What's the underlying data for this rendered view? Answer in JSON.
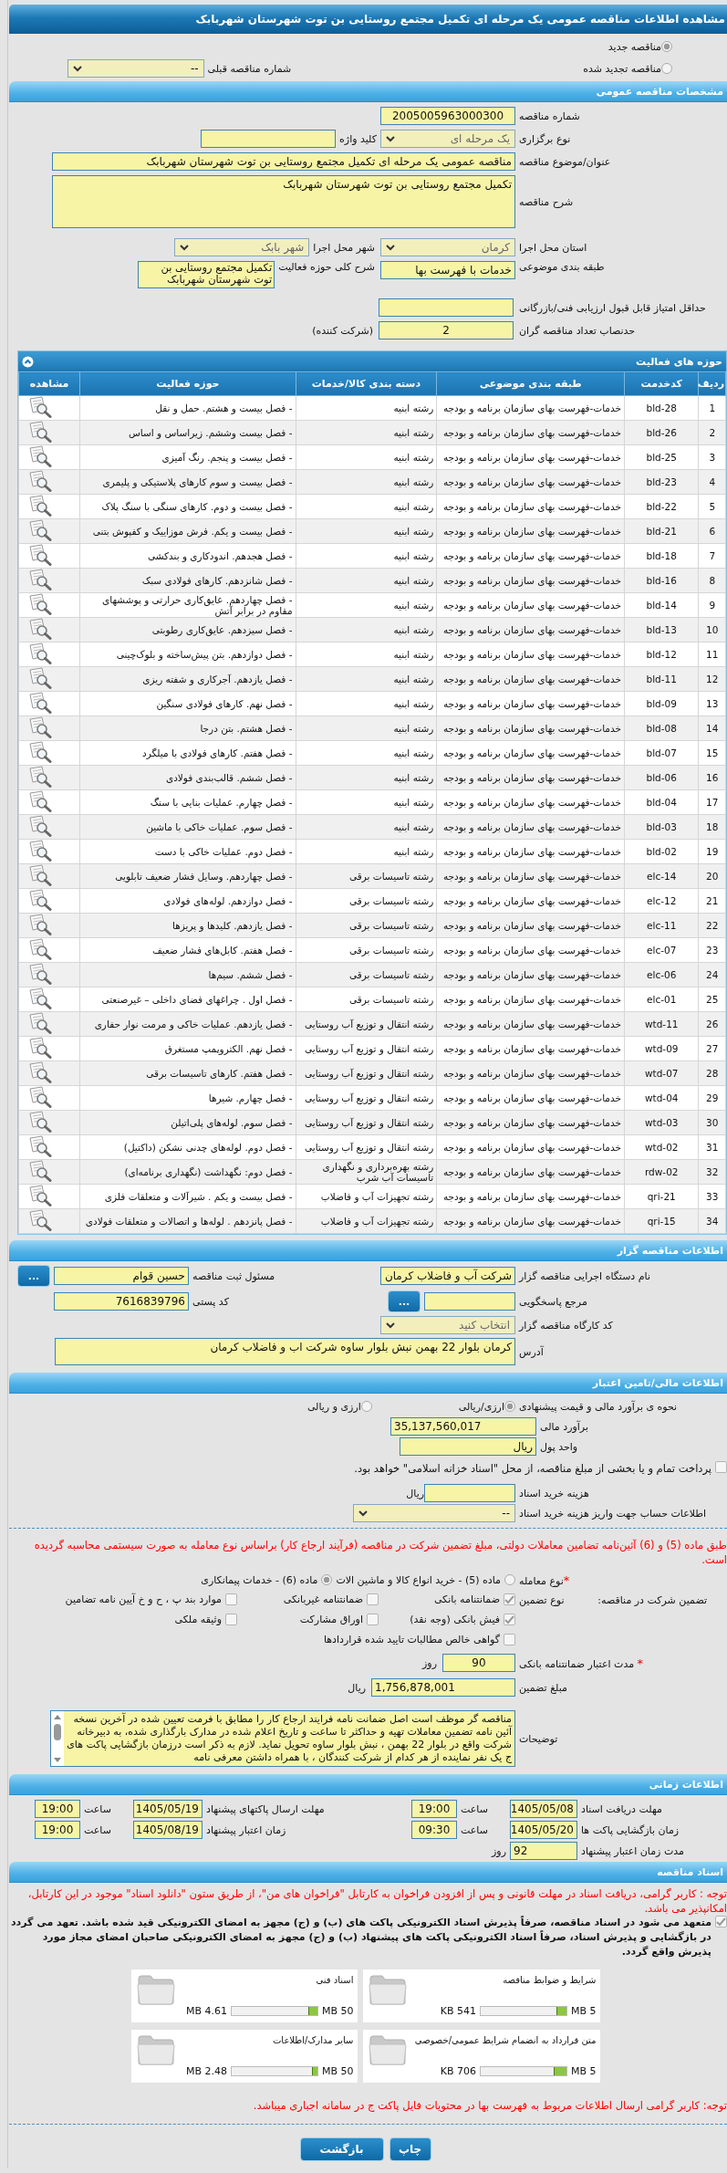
{
  "page_title": "مشاهده اطلاعات مناقصه عمومی یک مرحله ای تکمیل مجتمع روستایی بن توت شهرستان شهربابک",
  "tender_kind": {
    "options": [
      {
        "label": "مناقصه جدید",
        "selected": true
      },
      {
        "label": "مناقصه تجدید شده",
        "selected": false
      }
    ],
    "previous_label": "شماره مناقصه قبلی",
    "previous_value": "--"
  },
  "general": {
    "title": "مشخصات مناقصه عمومی",
    "tender_number": {
      "label": "شماره مناقصه",
      "value": "2005005963000300"
    },
    "holding_type": {
      "label": "نوع برگزاری",
      "value": "یک مرحله ای"
    },
    "keyword": {
      "label": "کلید واژه"
    },
    "subject": {
      "label": "عنوان/موضوع مناقصه",
      "value": "مناقصه عمومی یک مرحله ای تکمیل مجتمع روستایی بن توت شهرستان شهربابک"
    },
    "description": {
      "label": "شرح مناقصه",
      "value": "تکمیل مجتمع روستایی بن توت شهرستان شهربابک"
    },
    "province": {
      "label": "استان محل اجرا",
      "value": "کرمان"
    },
    "city": {
      "label": "شهر محل اجرا",
      "value": "شهر بابک"
    },
    "category": {
      "label": "طبقه بندی موضوعی",
      "value": "خدمات با فهرست بها"
    },
    "activity_summary": {
      "label": "شرح کلی حوزه فعالیت",
      "value": "تکمیل مجتمع روستایی بن توت شهرستان شهربابک"
    },
    "min_score": {
      "label": "حداقل امتیاز قابل قبول ارزیابی فنی/بازرگانی"
    },
    "min_bidders": {
      "label": "حدنصاب تعداد مناقصه گران",
      "value": "2",
      "unit": "(شرکت کننده)"
    }
  },
  "activities": {
    "title": "حوزه های فعالیت",
    "columns": [
      "ردیف",
      "کدخدمت",
      "طبقه بندی موضوعی",
      "دسته بندی کالا/خدمات",
      "حوزه فعالیت",
      "مشاهده"
    ],
    "rows": [
      {
        "row": "1",
        "code": "bld-28",
        "category": "خدمات-فهرست بهای سازمان برنامه و بودجه",
        "group": "رشته ابنیه",
        "activity": "- فصل بیست و هشتم. حمل و نقل"
      },
      {
        "row": "2",
        "code": "bld-26",
        "category": "خدمات-فهرست بهای سازمان برنامه و بودجه",
        "group": "رشته ابنیه",
        "activity": "- فصل بیست وششم. زیراساس و اساس"
      },
      {
        "row": "3",
        "code": "bld-25",
        "category": "خدمات-فهرست بهای سازمان برنامه و بودجه",
        "group": "رشته ابنیه",
        "activity": "- فصل بیست و پنجم. رنگ آمیزی"
      },
      {
        "row": "4",
        "code": "bld-23",
        "category": "خدمات-فهرست بهای سازمان برنامه و بودجه",
        "group": "رشته ابنیه",
        "activity": "- فصل بیست و سوم کارهای پلاستیکی و پلیمری"
      },
      {
        "row": "5",
        "code": "bld-22",
        "category": "خدمات-فهرست بهای سازمان برنامه و بودجه",
        "group": "رشته ابنیه",
        "activity": "- فصل بیست و دوم. کارهای سنگی با سنگ پلاک"
      },
      {
        "row": "6",
        "code": "bld-21",
        "category": "خدمات-فهرست بهای سازمان برنامه و بودجه",
        "group": "رشته ابنیه",
        "activity": "- فصل بیست و یکم. فرش موزاییک و کفپوش بتنی"
      },
      {
        "row": "7",
        "code": "bld-18",
        "category": "خدمات-فهرست بهای سازمان برنامه و بودجه",
        "group": "رشته ابنیه",
        "activity": "- فصل هجدهم. اندودکاری و بندکشی"
      },
      {
        "row": "8",
        "code": "bld-16",
        "category": "خدمات-فهرست بهای سازمان برنامه و بودجه",
        "group": "رشته ابنیه",
        "activity": "- فصل شانزدهم. کارهای فولادی سبک"
      },
      {
        "row": "9",
        "code": "bld-14",
        "category": "خدمات-فهرست بهای سازمان برنامه و بودجه",
        "group": "رشته ابنیه",
        "activity": "- فصل چهاردهم. عایق‌کاری حرارتی و پوششهای مقاوم در برابر آتش"
      },
      {
        "row": "10",
        "code": "bld-13",
        "category": "خدمات-فهرست بهای سازمان برنامه و بودجه",
        "group": "رشته ابنیه",
        "activity": "- فصل سیزدهم. عایق‌کاری رطوبتی"
      },
      {
        "row": "11",
        "code": "bld-12",
        "category": "خدمات-فهرست بهای سازمان برنامه و بودجه",
        "group": "رشته ابنیه",
        "activity": "- فصل دوازدهم. بتن پیش‌ساخته و بلوک‌چینی"
      },
      {
        "row": "12",
        "code": "bld-11",
        "category": "خدمات-فهرست بهای سازمان برنامه و بودجه",
        "group": "رشته ابنیه",
        "activity": "- فصل یازدهم. آجرکاری و شفته ریزی"
      },
      {
        "row": "13",
        "code": "bld-09",
        "category": "خدمات-فهرست بهای سازمان برنامه و بودجه",
        "group": "رشته ابنیه",
        "activity": "- فصل نهم. کارهای فولادی سنگین"
      },
      {
        "row": "14",
        "code": "bld-08",
        "category": "خدمات-فهرست بهای سازمان برنامه و بودجه",
        "group": "رشته ابنیه",
        "activity": "- فصل هشتم. بتن درجا"
      },
      {
        "row": "15",
        "code": "bld-07",
        "category": "خدمات-فهرست بهای سازمان برنامه و بودجه",
        "group": "رشته ابنیه",
        "activity": "- فصل هفتم. کارهای فولادی با میلگرد"
      },
      {
        "row": "16",
        "code": "bld-06",
        "category": "خدمات-فهرست بهای سازمان برنامه و بودجه",
        "group": "رشته ابنیه",
        "activity": "- فصل ششم. قالب‌بندی فولادی"
      },
      {
        "row": "17",
        "code": "bld-04",
        "category": "خدمات-فهرست بهای سازمان برنامه و بودجه",
        "group": "رشته ابنیه",
        "activity": "- فصل چهارم. عملیات بنایی با سنگ"
      },
      {
        "row": "18",
        "code": "bld-03",
        "category": "خدمات-فهرست بهای سازمان برنامه و بودجه",
        "group": "رشته ابنیه",
        "activity": "- فصل سوم. عملیات خاکی با ماشین"
      },
      {
        "row": "19",
        "code": "bld-02",
        "category": "خدمات-فهرست بهای سازمان برنامه و بودجه",
        "group": "رشته ابنیه",
        "activity": "- فصل دوم. عملیات خاکی با دست"
      },
      {
        "row": "20",
        "code": "elc-14",
        "category": "خدمات-فهرست بهای سازمان برنامه و بودجه",
        "group": "رشته تاسیسات برقی",
        "activity": "- فصل چهاردهم. وسایل فشار ضعیف تابلویی"
      },
      {
        "row": "21",
        "code": "elc-12",
        "category": "خدمات-فهرست بهای سازمان برنامه و بودجه",
        "group": "رشته تاسیسات برقی",
        "activity": "- فصل دوازدهم. لوله‌های فولادی"
      },
      {
        "row": "22",
        "code": "elc-11",
        "category": "خدمات-فهرست بهای سازمان برنامه و بودجه",
        "group": "رشته تاسیسات برقی",
        "activity": "- فصل یازدهم. کلیدها و پریزها"
      },
      {
        "row": "23",
        "code": "elc-07",
        "category": "خدمات-فهرست بهای سازمان برنامه و بودجه",
        "group": "رشته تاسیسات برقی",
        "activity": "- فصل هفتم. کابل‌های فشار ضعیف"
      },
      {
        "row": "24",
        "code": "elc-06",
        "category": "خدمات-فهرست بهای سازمان برنامه و بودجه",
        "group": "رشته تاسیسات برقی",
        "activity": "- فصل ششم. سیم‌ها"
      },
      {
        "row": "25",
        "code": "elc-01",
        "category": "خدمات-فهرست بهای سازمان برنامه و بودجه",
        "group": "رشته تاسیسات برقی",
        "activity": "- فصل اول . چراغهای فضای داخلی – غیرصنعتی"
      },
      {
        "row": "26",
        "code": "wtd-11",
        "category": "خدمات-فهرست بهای سازمان برنامه و بودجه",
        "group": "رشته انتقال و توزیع آب روستایی",
        "activity": "- فصل یازدهم. عملیات خاکی و مرمت نوار حفاری"
      },
      {
        "row": "27",
        "code": "wtd-09",
        "category": "خدمات-فهرست بهای سازمان برنامه و بودجه",
        "group": "رشته انتقال و توزیع آب روستایی",
        "activity": "- فصل نهم. الکتروپمپ مستغرق"
      },
      {
        "row": "28",
        "code": "wtd-07",
        "category": "خدمات-فهرست بهای سازمان برنامه و بودجه",
        "group": "رشته انتقال و توزیع آب روستایی",
        "activity": "- فصل هفتم. کارهای تاسیسات برقی"
      },
      {
        "row": "29",
        "code": "wtd-04",
        "category": "خدمات-فهرست بهای سازمان برنامه و بودجه",
        "group": "رشته انتقال و توزیع آب روستایی",
        "activity": "- فصل چهارم. شیرها"
      },
      {
        "row": "30",
        "code": "wtd-03",
        "category": "خدمات-فهرست بهای سازمان برنامه و بودجه",
        "group": "رشته انتقال و توزیع آب روستایی",
        "activity": "- فصل سوم. لوله‌های پلی‌اتیلن"
      },
      {
        "row": "31",
        "code": "wtd-02",
        "category": "خدمات-فهرست بهای سازمان برنامه و بودجه",
        "group": "رشته انتقال و توزیع آب روستایی",
        "activity": "- فصل دوم. لوله‌های چدنی نشکن (داکتیل)"
      },
      {
        "row": "32",
        "code": "rdw-02",
        "category": "خدمات-فهرست بهای سازمان برنامه و بودجه",
        "group": "رشته بهره‌برداری و نگهداری تاسیسات آب شرب",
        "activity": "- فصل دوم: نگهداشت (نگهداری برنامه‌ای)"
      },
      {
        "row": "33",
        "code": "qri-21",
        "category": "خدمات-فهرست بهای سازمان برنامه و بودجه",
        "group": "رشته تجهیزات آب و فاضلاب",
        "activity": "- فصل بیست و یکم . شیرآلات و متعلقات فلزی"
      },
      {
        "row": "34",
        "code": "qri-15",
        "category": "خدمات-فهرست بهای سازمان برنامه و بودجه",
        "group": "رشته تجهیزات آب و فاضلاب",
        "activity": "- فصل پانزدهم . لوله‌ها و اتصالات و متعلقات فولادی"
      }
    ]
  },
  "issuer": {
    "title": "اطلاعات مناقصه گزار",
    "organization": {
      "label": "نام دستگاه اجرایی مناقصه گزار",
      "value": "شرکت آب و فاضلاب کرمان"
    },
    "registrar": {
      "label": "مسئول ثبت مناقصه",
      "value": "حسین قوام",
      "button": "..."
    },
    "reference": {
      "label": "مرجع پاسخگویی",
      "button": "..."
    },
    "postal_code": {
      "label": "کد پستی",
      "value": "7616839796"
    },
    "workshop_code": {
      "label": "کد کارگاه مناقصه گزار",
      "value": "انتخاب کنید"
    },
    "address": {
      "label": "آدرس",
      "value": "کرمان بلوار 22 بهمن نبش بلوار ساوه شرکت اب و فاضلاب کرمان"
    }
  },
  "finance": {
    "title": "اطلاعات مالی/تامین اعتبار",
    "estimate_method": {
      "label": "نحوه ی برآورد مالی و قیمت پیشنهادی",
      "options": [
        {
          "label": "ارزی/ریالی",
          "selected": true
        },
        {
          "label": "ارزی و ریالی",
          "selected": false
        }
      ]
    },
    "estimate": {
      "label": "برآورد مالی",
      "value": "35,137,560,017"
    },
    "currency": {
      "label": "واحد پول",
      "value": "ریال"
    },
    "treasury": {
      "label": "پرداخت تمام و یا بخشی از مبلغ مناقصه، از محل \"اسناد خزانه اسلامی\" خواهد بود.",
      "checked": false
    },
    "document_fee": {
      "label": "هزینه خرید اسناد",
      "unit": "ریال"
    },
    "account_info": {
      "label": "اطلاعات حساب جهت واریز هزینه خرید اسناد",
      "value": "--"
    },
    "note": "طبق ماده (5) و (6) آئین‌نامه تضامین معاملات دولتی، مبلغ تضمین شرکت در مناقصه (فرآیند ارجاع کار) براساس نوع معامله به صورت سیستمی محاسبه گردیده است."
  },
  "guarantee": {
    "deal_type": {
      "label": "نوع معامله",
      "required_mark": "*",
      "options": [
        {
          "label": "ماده (5) - خرید انواع کالا و ماشین الات",
          "selected": false
        },
        {
          "label": "ماده (6) - خدمات پیمانکاری",
          "selected": true
        }
      ]
    },
    "participation_label": "تضمین شرکت در مناقصه:",
    "type_label": "نوع تضمین",
    "types": [
      {
        "label": "ضمانتنامه بانکی",
        "checked": true
      },
      {
        "label": "ضمانتنامه غیربانکی",
        "checked": false
      },
      {
        "label": "موارد بند پ ، ح و خ آیین نامه تضامین",
        "checked": false
      },
      {
        "label": "فیش بانکی (وجه نقد)",
        "checked": true
      },
      {
        "label": "اوراق مشارکت",
        "checked": false
      },
      {
        "label": "وثیقه ملکی",
        "checked": false
      },
      {
        "label": "گواهی خالص مطالبات تایید شده قراردادها",
        "checked": false
      }
    ],
    "validity": {
      "label": "مدت اعتبار ضمانتنامه بانکی",
      "required_mark": "*",
      "value": "90",
      "unit": "روز"
    },
    "amount": {
      "label": "مبلغ تضمین",
      "value": "1,756,878,001",
      "unit": "ریال"
    },
    "notes": {
      "label": "توضیحات",
      "value": "مناقصه گر موظف است اصل ضمانت نامه فرایند ارجاع کار را مطابق با فرمت تعیین شده در آخرین نسخه آئین نامه تضمین معاملات  تهیه و حداکثر تا ساعت و تاریخ اعلام شده در مدارک بارگذاری شده، به  دبیرخانه شرکت واقع در بلوار 22 بهمن ، نبش بلوار ساوه تحویل نماید. لازم به ذکر است   درزمان بازگشایی پاکت های  ج  یک نفر نماینده از هر کدام از شرکت کنندگان ، با همراه داشتن معرفی نامه"
    }
  },
  "timing": {
    "title": "اطلاعات زمانی",
    "rows": [
      [
        {
          "label": "مهلت دریافت اسناد",
          "date": "1405/05/08",
          "time_label": "ساعت",
          "time": "19:00"
        },
        {
          "label": "مهلت ارسال پاکتهای پیشنهاد",
          "date": "1405/05/19",
          "time_label": "ساعت",
          "time": "19:00"
        }
      ],
      [
        {
          "label": "زمان بازگشایی پاکت ها",
          "date": "1405/05/20",
          "time_label": "ساعت",
          "time": "09:30"
        },
        {
          "label": "زمان اعتبار پیشنهاد",
          "date": "1405/08/19",
          "time_label": "ساعت",
          "time": "19:00"
        }
      ]
    ],
    "validity": {
      "label": "مدت زمان اعتبار پیشنهاد",
      "value": "92",
      "unit": "روز"
    }
  },
  "documents": {
    "title": "اسناد مناقصه",
    "note": "توجه : کاربر گرامی، دریافت اسناد در مهلت قانونی و پس از افزودن فراخوان به کارتابل \"فراخوان های من\"، از طریق ستون \"دانلود اسناد\" موجود در این کارتابل، امکانپذیر می باشد.",
    "commitment": {
      "text": "متعهد می شود در اسناد مناقصه، صرفاً پذیرش اسناد الکترونیکی پاکت های (ب) و (ج) مجهز به امضای الکترونیکی قید شده باشد. تعهد می گردد در بازگشایی و پذیرش اسناد، صرفاً اسناد الکترونیکی پاکت های پیشنهاد (ب) و (ج) مجهز به امضای الکترونیکی صاحبان امضای مجاز مورد پذیرش واقع گردد.",
      "checked": true
    },
    "files": [
      {
        "name": "شرایط و ضوابط مناقصه",
        "used": "541 KB",
        "max": "5 MB",
        "level": 0.105
      },
      {
        "name": "اسناد فنی",
        "used": "4.61 MB",
        "max": "50 MB",
        "level": 0.092
      },
      {
        "name": "متن قرارداد به انضمام شرایط عمومی/خصوصی",
        "used": "706 KB",
        "max": "5 MB",
        "level": 0.138
      },
      {
        "name": "سایر مدارک/اطلاعات",
        "used": "2.48 MB",
        "max": "50 MB",
        "level": 0.05
      }
    ],
    "footer_note": "توجه: کاربر گرامی ارسال اطلاعات مربوط به فهرست بها در محتویات فایل پاکت ج در سامانه اجباری میباشد."
  },
  "buttons": [
    "چاپ",
    "بازگشت"
  ]
}
